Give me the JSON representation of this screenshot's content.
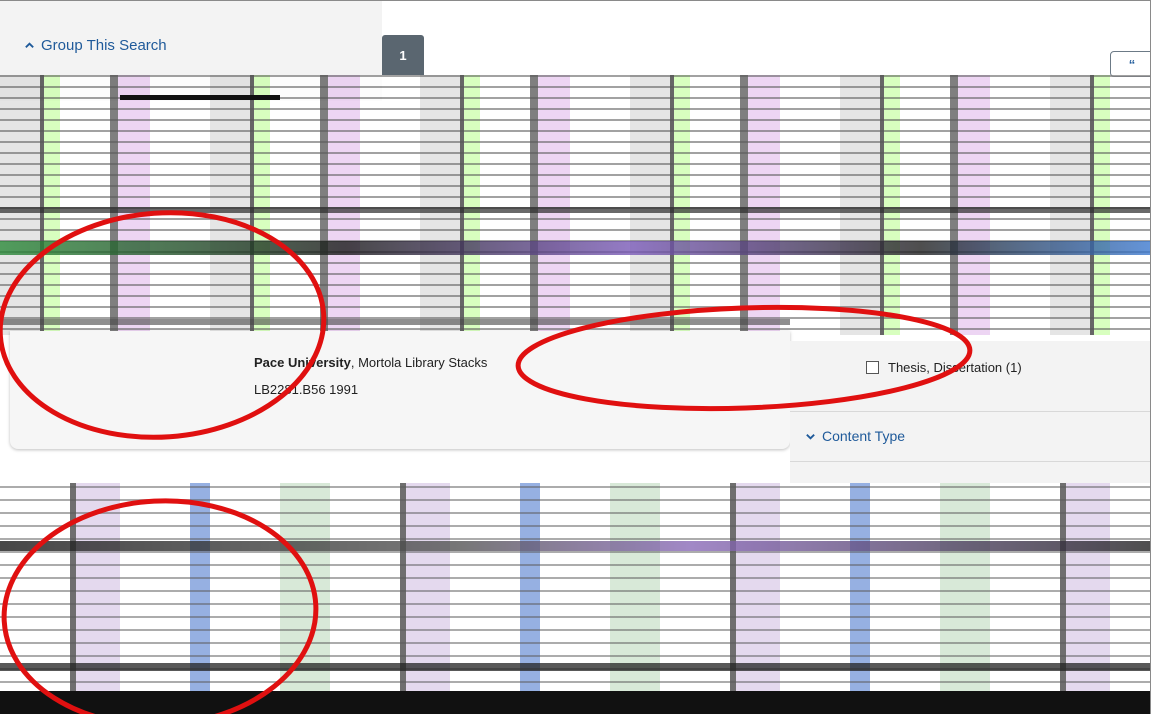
{
  "left_facets": {
    "group_this_search": "Group This Search"
  },
  "result": {
    "number": "1",
    "cite_icon": "quote-icon",
    "cite_glyph": "“"
  },
  "holding": {
    "institution": "Pace University",
    "location": ", Mortola Library Stacks",
    "call_number": "LB2281.B56 1991"
  },
  "right_facets": {
    "resource_type_option": "Thesis, Dissertation (1)",
    "content_type": "Content Type"
  },
  "colors": {
    "link": "#1f5a9a",
    "annotation": "#e01010",
    "badge": "#5a6670"
  }
}
